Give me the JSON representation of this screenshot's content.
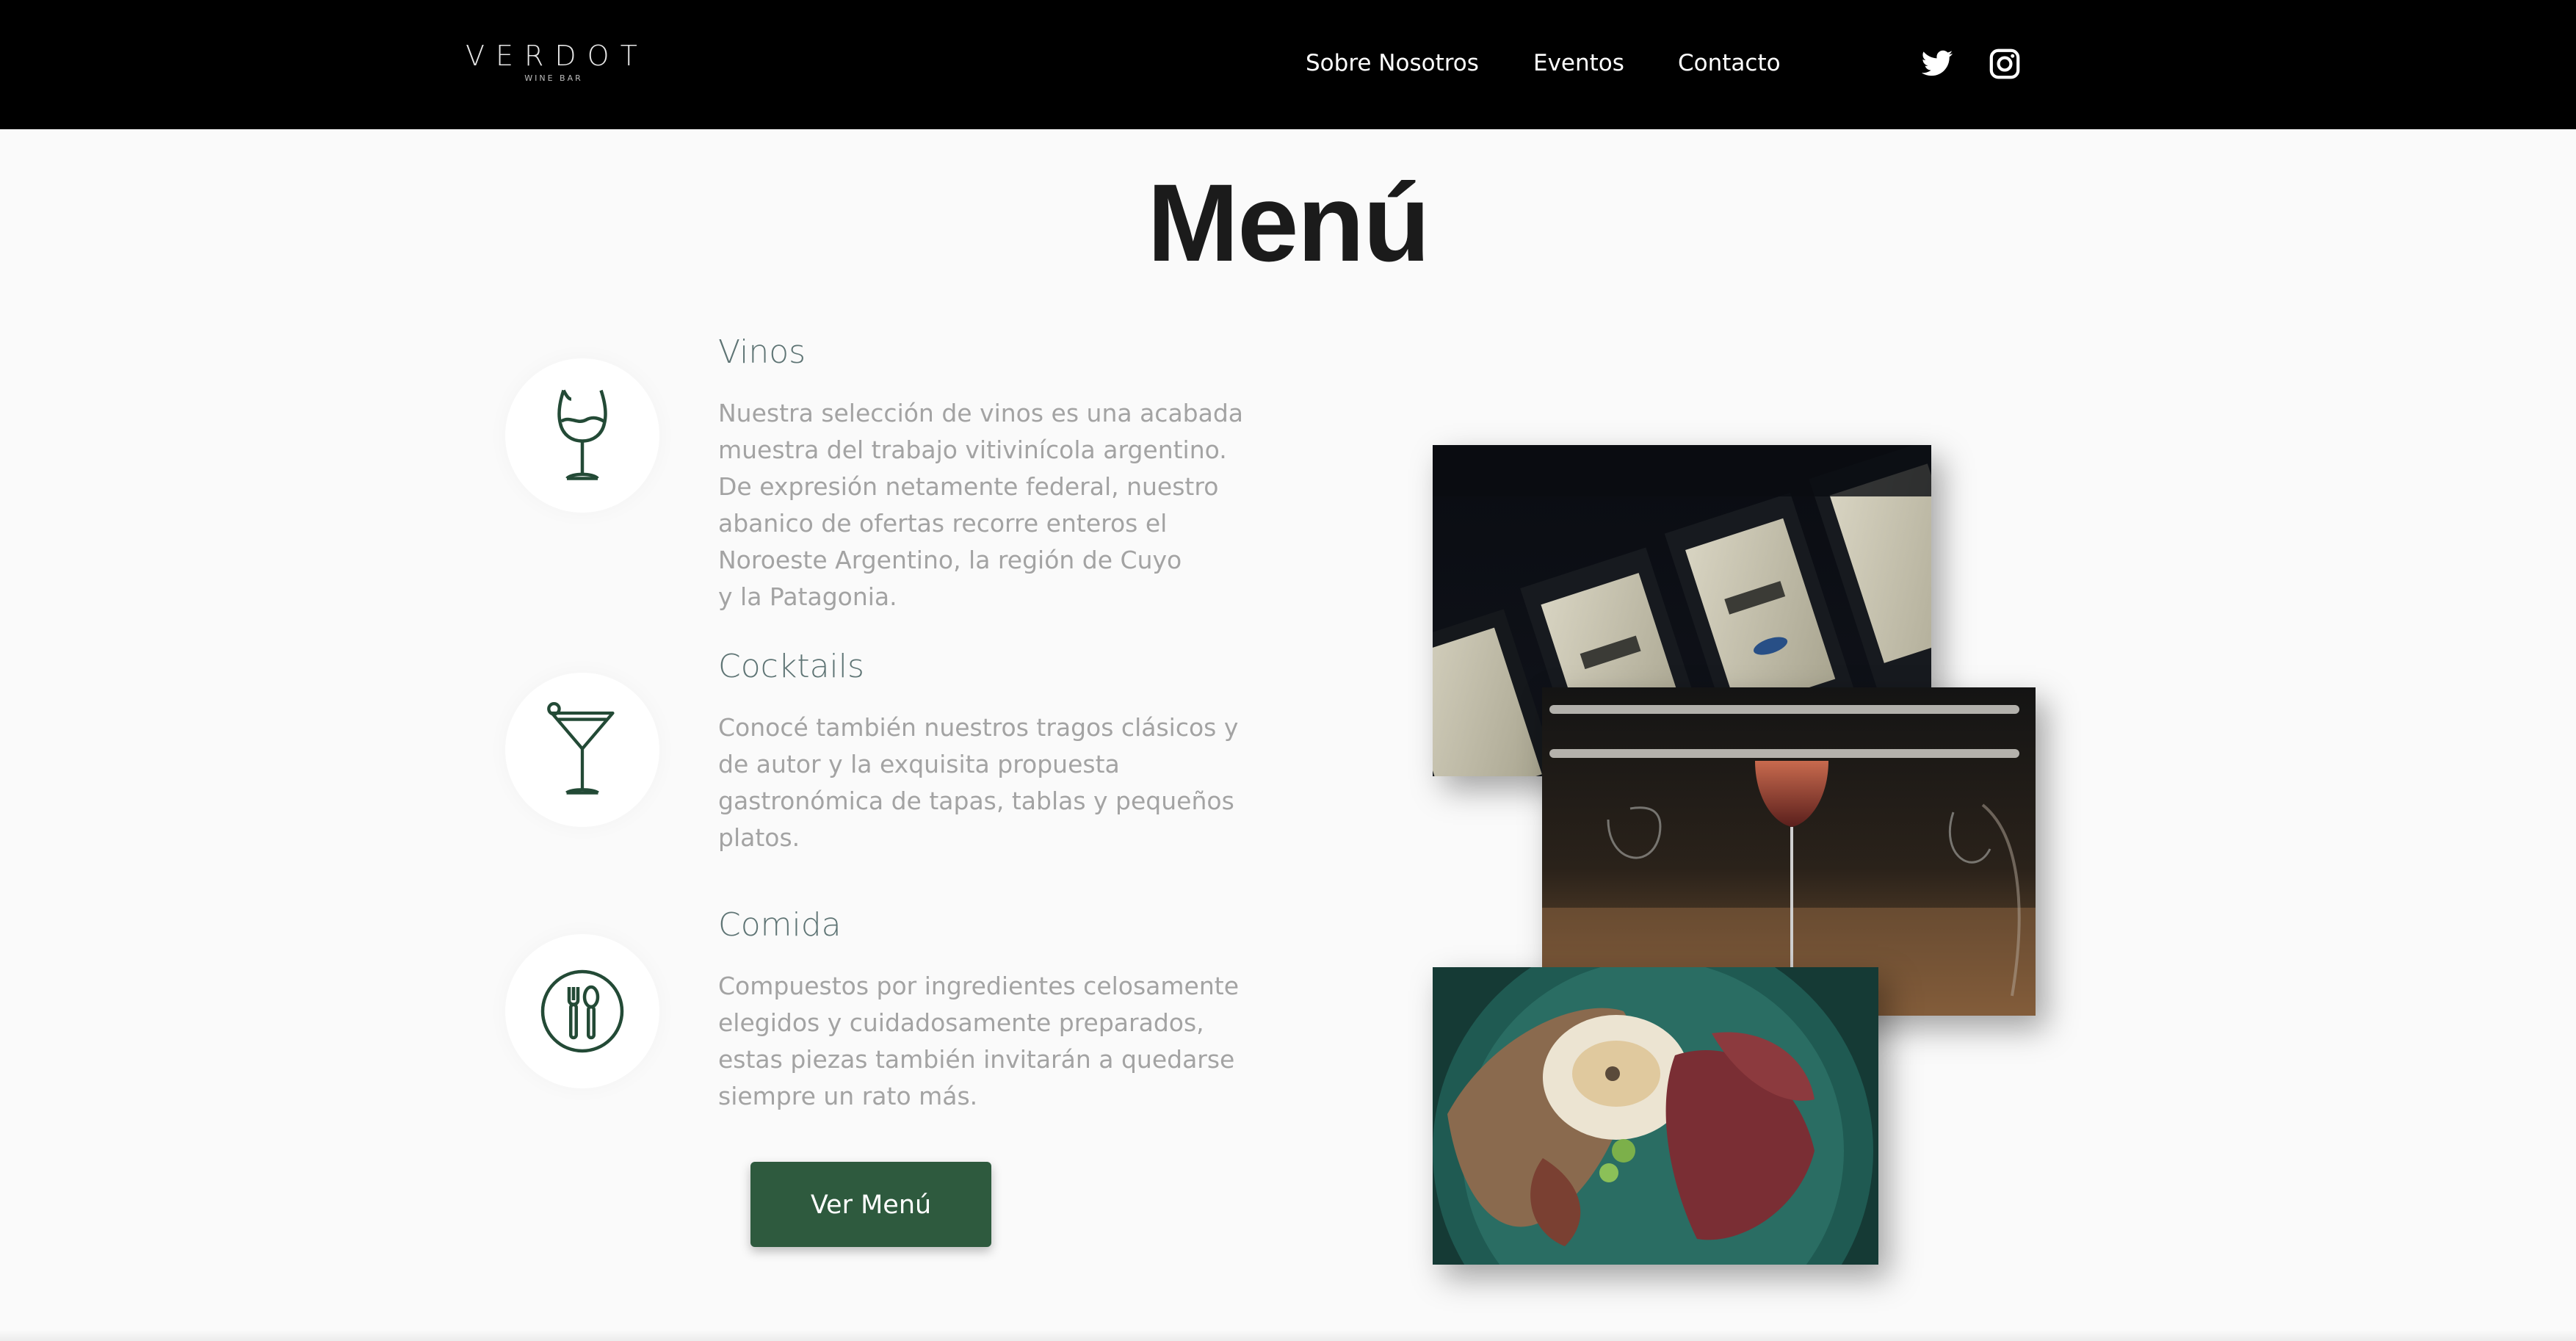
{
  "header": {
    "logo": {
      "name": "VERDOT",
      "tagline": "WINE BAR"
    },
    "nav": [
      {
        "label": "Sobre Nosotros"
      },
      {
        "label": "Eventos"
      },
      {
        "label": "Contacto"
      }
    ],
    "social": [
      {
        "icon": "twitter-icon"
      },
      {
        "icon": "instagram-icon"
      }
    ]
  },
  "main": {
    "title": "Menú",
    "sections": [
      {
        "icon": "wine-glass-icon",
        "title": "Vinos",
        "lines": [
          "Nuestra selección de vinos es una acabada",
          "muestra del trabajo vitivinícola argentino.",
          "De expresión netamente federal, nuestro",
          "abanico de ofertas recorre enteros el",
          "Noroeste Argentino, la región de Cuyo",
          "y la Patagonia."
        ]
      },
      {
        "icon": "cocktail-glass-icon",
        "title": "Cocktails",
        "lines": [
          "Conocé también nuestros tragos clásicos y",
          "de autor y la exquisita propuesta",
          "gastronómica de tapas, tablas y pequeños",
          "platos."
        ]
      },
      {
        "icon": "cutlery-icon",
        "title": "Comida",
        "lines": [
          "Compuestos por ingredientes celosamente",
          "elegidos y cuidadosamente preparados,",
          "estas piezas también invitarán a quedarse",
          "siempre un rato más."
        ]
      }
    ],
    "button": {
      "label": "Ver Menú"
    }
  },
  "colors": {
    "header_bg": "#000000",
    "accent_green": "#2e5a3e",
    "section_title": "#5e7474",
    "body_text": "#a3a3a3"
  }
}
